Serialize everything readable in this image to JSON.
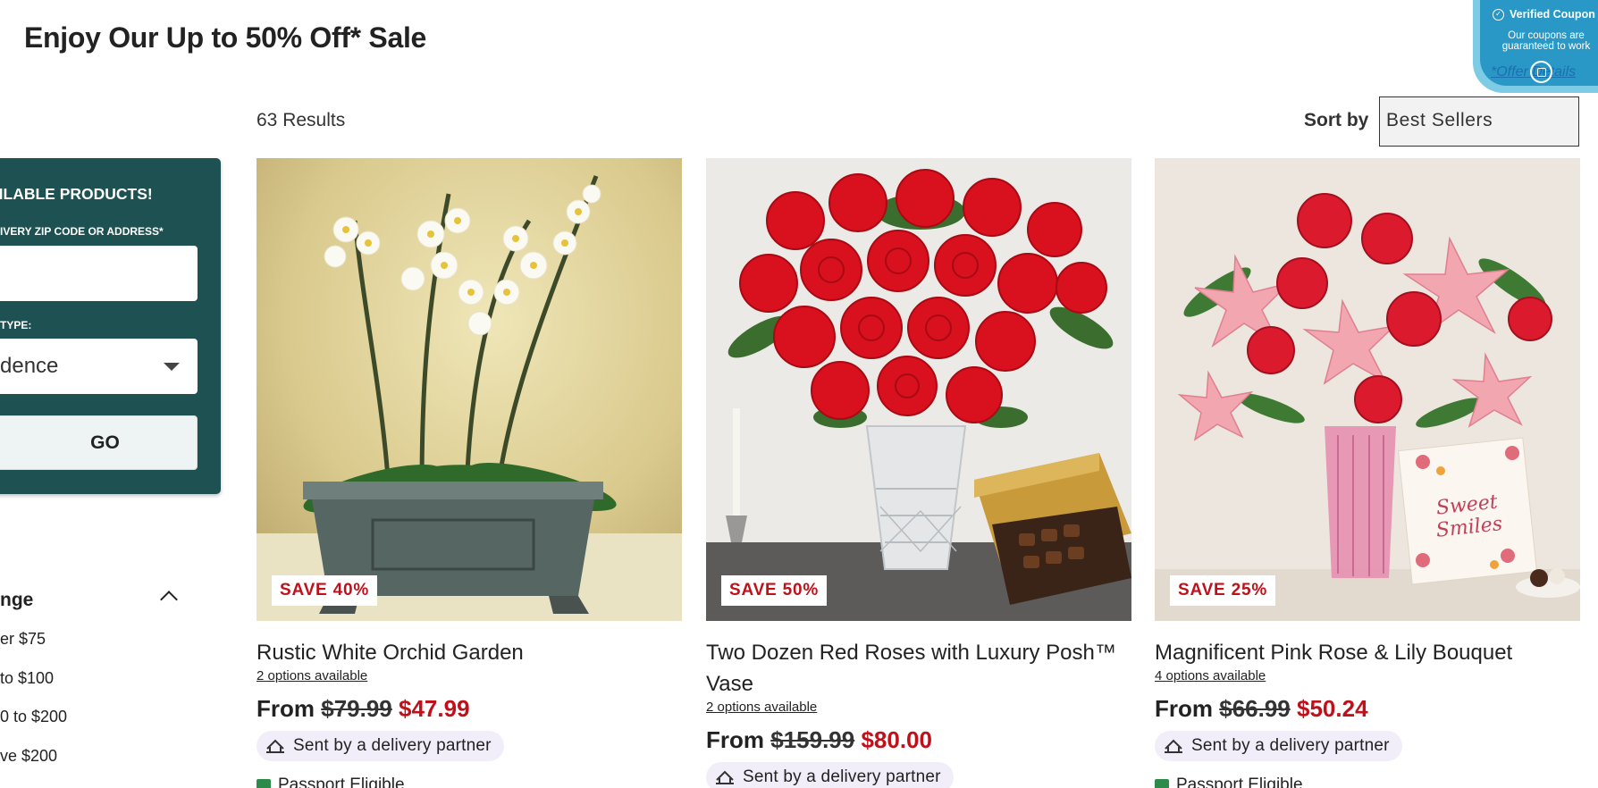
{
  "page": {
    "title": "Enjoy Our Up to 50% Off* Sale"
  },
  "coupon": {
    "title": "Verified Coupon",
    "subtitle": "Our coupons are guaranteed to work",
    "link": "*Offer Details"
  },
  "results": {
    "count_label": "63 Results",
    "sort_label": "Sort by",
    "sort_value": "Best Sellers"
  },
  "zip_panel": {
    "heading": "AILABLE PRODUCTS!",
    "zip_label": "IVERY ZIP CODE OR ADDRESS*",
    "zip_value": "",
    "type_label": "TYPE:",
    "type_value": "dence",
    "go_label": "GO"
  },
  "filter": {
    "heading": "nge",
    "options": [
      "er $75",
      " to $100",
      "0 to $200",
      "ve $200"
    ]
  },
  "products": [
    {
      "name": "Rustic White Orchid Garden",
      "options": "2 options available",
      "price_prefix": "From",
      "price_old": "$79.99",
      "price_new": "$47.99",
      "badge": "SAVE 40%",
      "delivery": "Sent by a delivery partner",
      "extra": "Passport Eligible",
      "image_icon": "orchid-planter-image"
    },
    {
      "name": "Two Dozen Red Roses with Luxury Posh™ Vase",
      "options": "2 options available",
      "price_prefix": "From",
      "price_old": "$159.99",
      "price_new": "$80.00",
      "badge": "SAVE 50%",
      "delivery": "Sent by a delivery partner",
      "extra": "",
      "image_icon": "red-roses-vase-image"
    },
    {
      "name": "Magnificent Pink Rose & Lily Bouquet",
      "options": "4 options available",
      "price_prefix": "From",
      "price_old": "$66.99",
      "price_new": "$50.24",
      "badge": "SAVE 25%",
      "delivery": "Sent by a delivery partner",
      "extra": "Passport Eligible",
      "image_icon": "pink-rose-lily-image"
    }
  ],
  "colors": {
    "panel": "#1e5151",
    "sale_red": "#c0101a",
    "coupon_blue": "#2a98c6",
    "delivery_chip": "#f1eef9"
  }
}
